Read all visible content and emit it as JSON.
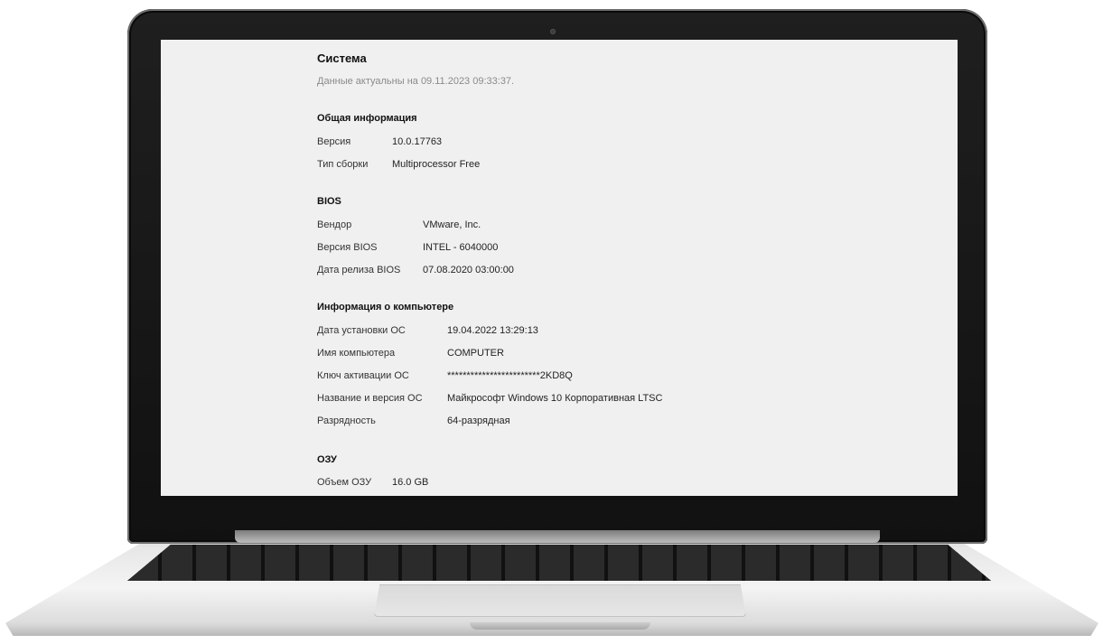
{
  "page": {
    "title": "Система",
    "subtitle": "Данные актуальны на 09.11.2023 09:33:37."
  },
  "sections": {
    "general": {
      "title": "Общая информация",
      "rows": [
        {
          "label": "Версия",
          "value": "10.0.17763"
        },
        {
          "label": "Тип сборки",
          "value": "Multiprocessor Free"
        }
      ]
    },
    "bios": {
      "title": "BIOS",
      "rows": [
        {
          "label": "Вендор",
          "value": "VMware, Inc."
        },
        {
          "label": "Версия BIOS",
          "value": "INTEL - 6040000"
        },
        {
          "label": "Дата релиза BIOS",
          "value": "07.08.2020 03:00:00"
        }
      ]
    },
    "computer": {
      "title": "Информация о компьютере",
      "rows": [
        {
          "label": "Дата установки ОС",
          "value": "19.04.2022 13:29:13"
        },
        {
          "label": "Имя компьютера",
          "value": "COMPUTER"
        },
        {
          "label": "Ключ активации ОС",
          "value": "************************2KD8Q"
        },
        {
          "label": "Название и версия ОС",
          "value": "Майкрософт Windows 10 Корпоративная LTSC"
        },
        {
          "label": "Разрядность",
          "value": "64-разрядная"
        }
      ]
    },
    "ram": {
      "title": "ОЗУ",
      "rows": [
        {
          "label": "Объем ОЗУ",
          "value": "16.0 GB"
        }
      ]
    }
  },
  "colors": {
    "screen_background": "#f0f0f0",
    "subtitle_text": "#8a8a8a",
    "bezel": "#111111",
    "chassis": "#e8e8e8"
  }
}
